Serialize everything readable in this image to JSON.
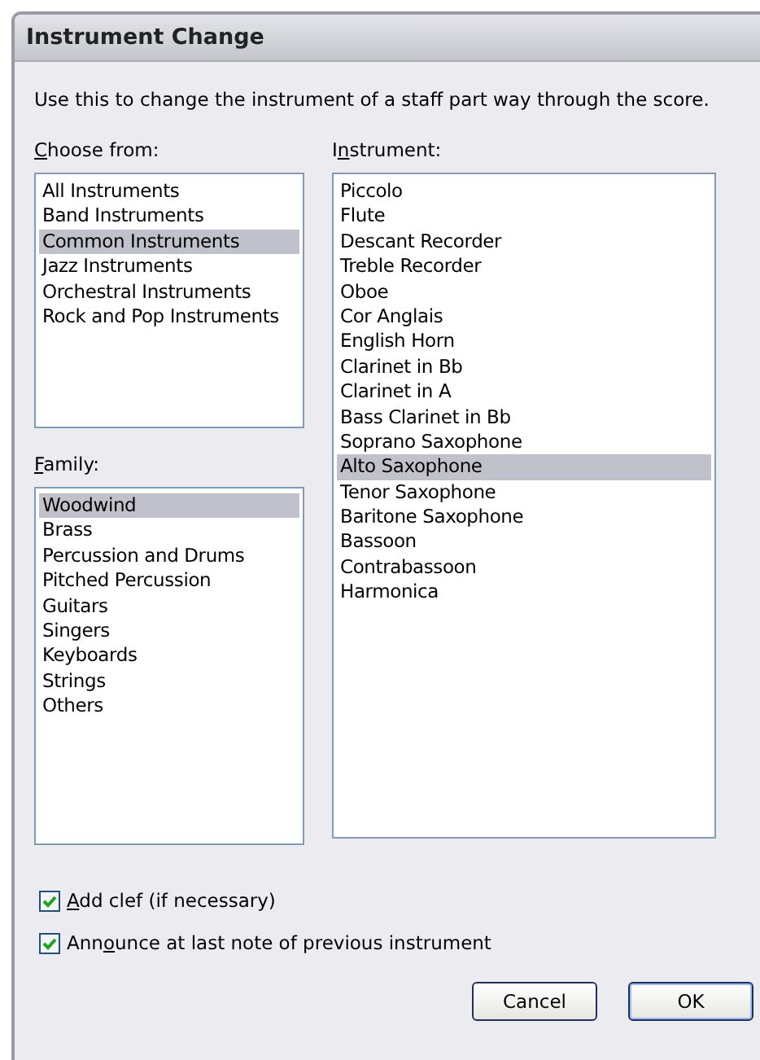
{
  "window": {
    "title": "Instrument Change"
  },
  "description": "Use this to change the instrument of a staff part way through the score.",
  "choose_from": {
    "label": {
      "key": "C",
      "after": "hoose from:"
    },
    "items": [
      {
        "label": "All Instruments",
        "selected": false
      },
      {
        "label": "Band Instruments",
        "selected": false
      },
      {
        "label": "Common Instruments",
        "selected": true
      },
      {
        "label": "Jazz Instruments",
        "selected": false
      },
      {
        "label": "Orchestral Instruments",
        "selected": false
      },
      {
        "label": "Rock and Pop Instruments",
        "selected": false
      }
    ]
  },
  "family": {
    "label": {
      "key": "F",
      "after": "amily:"
    },
    "items": [
      {
        "label": "Woodwind",
        "selected": true
      },
      {
        "label": "Brass",
        "selected": false
      },
      {
        "label": "Percussion and Drums",
        "selected": false
      },
      {
        "label": "Pitched Percussion",
        "selected": false
      },
      {
        "label": "Guitars",
        "selected": false
      },
      {
        "label": "Singers",
        "selected": false
      },
      {
        "label": "Keyboards",
        "selected": false
      },
      {
        "label": "Strings",
        "selected": false
      },
      {
        "label": "Others",
        "selected": false
      }
    ]
  },
  "instrument": {
    "label": {
      "before": "I",
      "key": "n",
      "after": "strument:"
    },
    "items": [
      {
        "label": "Piccolo",
        "selected": false
      },
      {
        "label": "Flute",
        "selected": false
      },
      {
        "label": "Descant Recorder",
        "selected": false
      },
      {
        "label": "Treble Recorder",
        "selected": false
      },
      {
        "label": "Oboe",
        "selected": false
      },
      {
        "label": "Cor Anglais",
        "selected": false
      },
      {
        "label": "English Horn",
        "selected": false
      },
      {
        "label": "Clarinet in Bb",
        "selected": false
      },
      {
        "label": "Clarinet in A",
        "selected": false
      },
      {
        "label": "Bass Clarinet in Bb",
        "selected": false
      },
      {
        "label": "Soprano Saxophone",
        "selected": false
      },
      {
        "label": "Alto Saxophone",
        "selected": true
      },
      {
        "label": "Tenor Saxophone",
        "selected": false
      },
      {
        "label": "Baritone Saxophone",
        "selected": false
      },
      {
        "label": "Bassoon",
        "selected": false
      },
      {
        "label": "Contrabassoon",
        "selected": false
      },
      {
        "label": "Harmonica",
        "selected": false
      }
    ]
  },
  "checkboxes": [
    {
      "label": {
        "key": "A",
        "after": "dd clef (if necessary)"
      },
      "checked": true
    },
    {
      "label": {
        "before": "Ann",
        "key": "o",
        "after": "unce at last note of previous instrument"
      },
      "checked": true
    }
  ],
  "buttons": [
    {
      "label": "Cancel",
      "default": false
    },
    {
      "label": "OK",
      "default": true
    }
  ]
}
